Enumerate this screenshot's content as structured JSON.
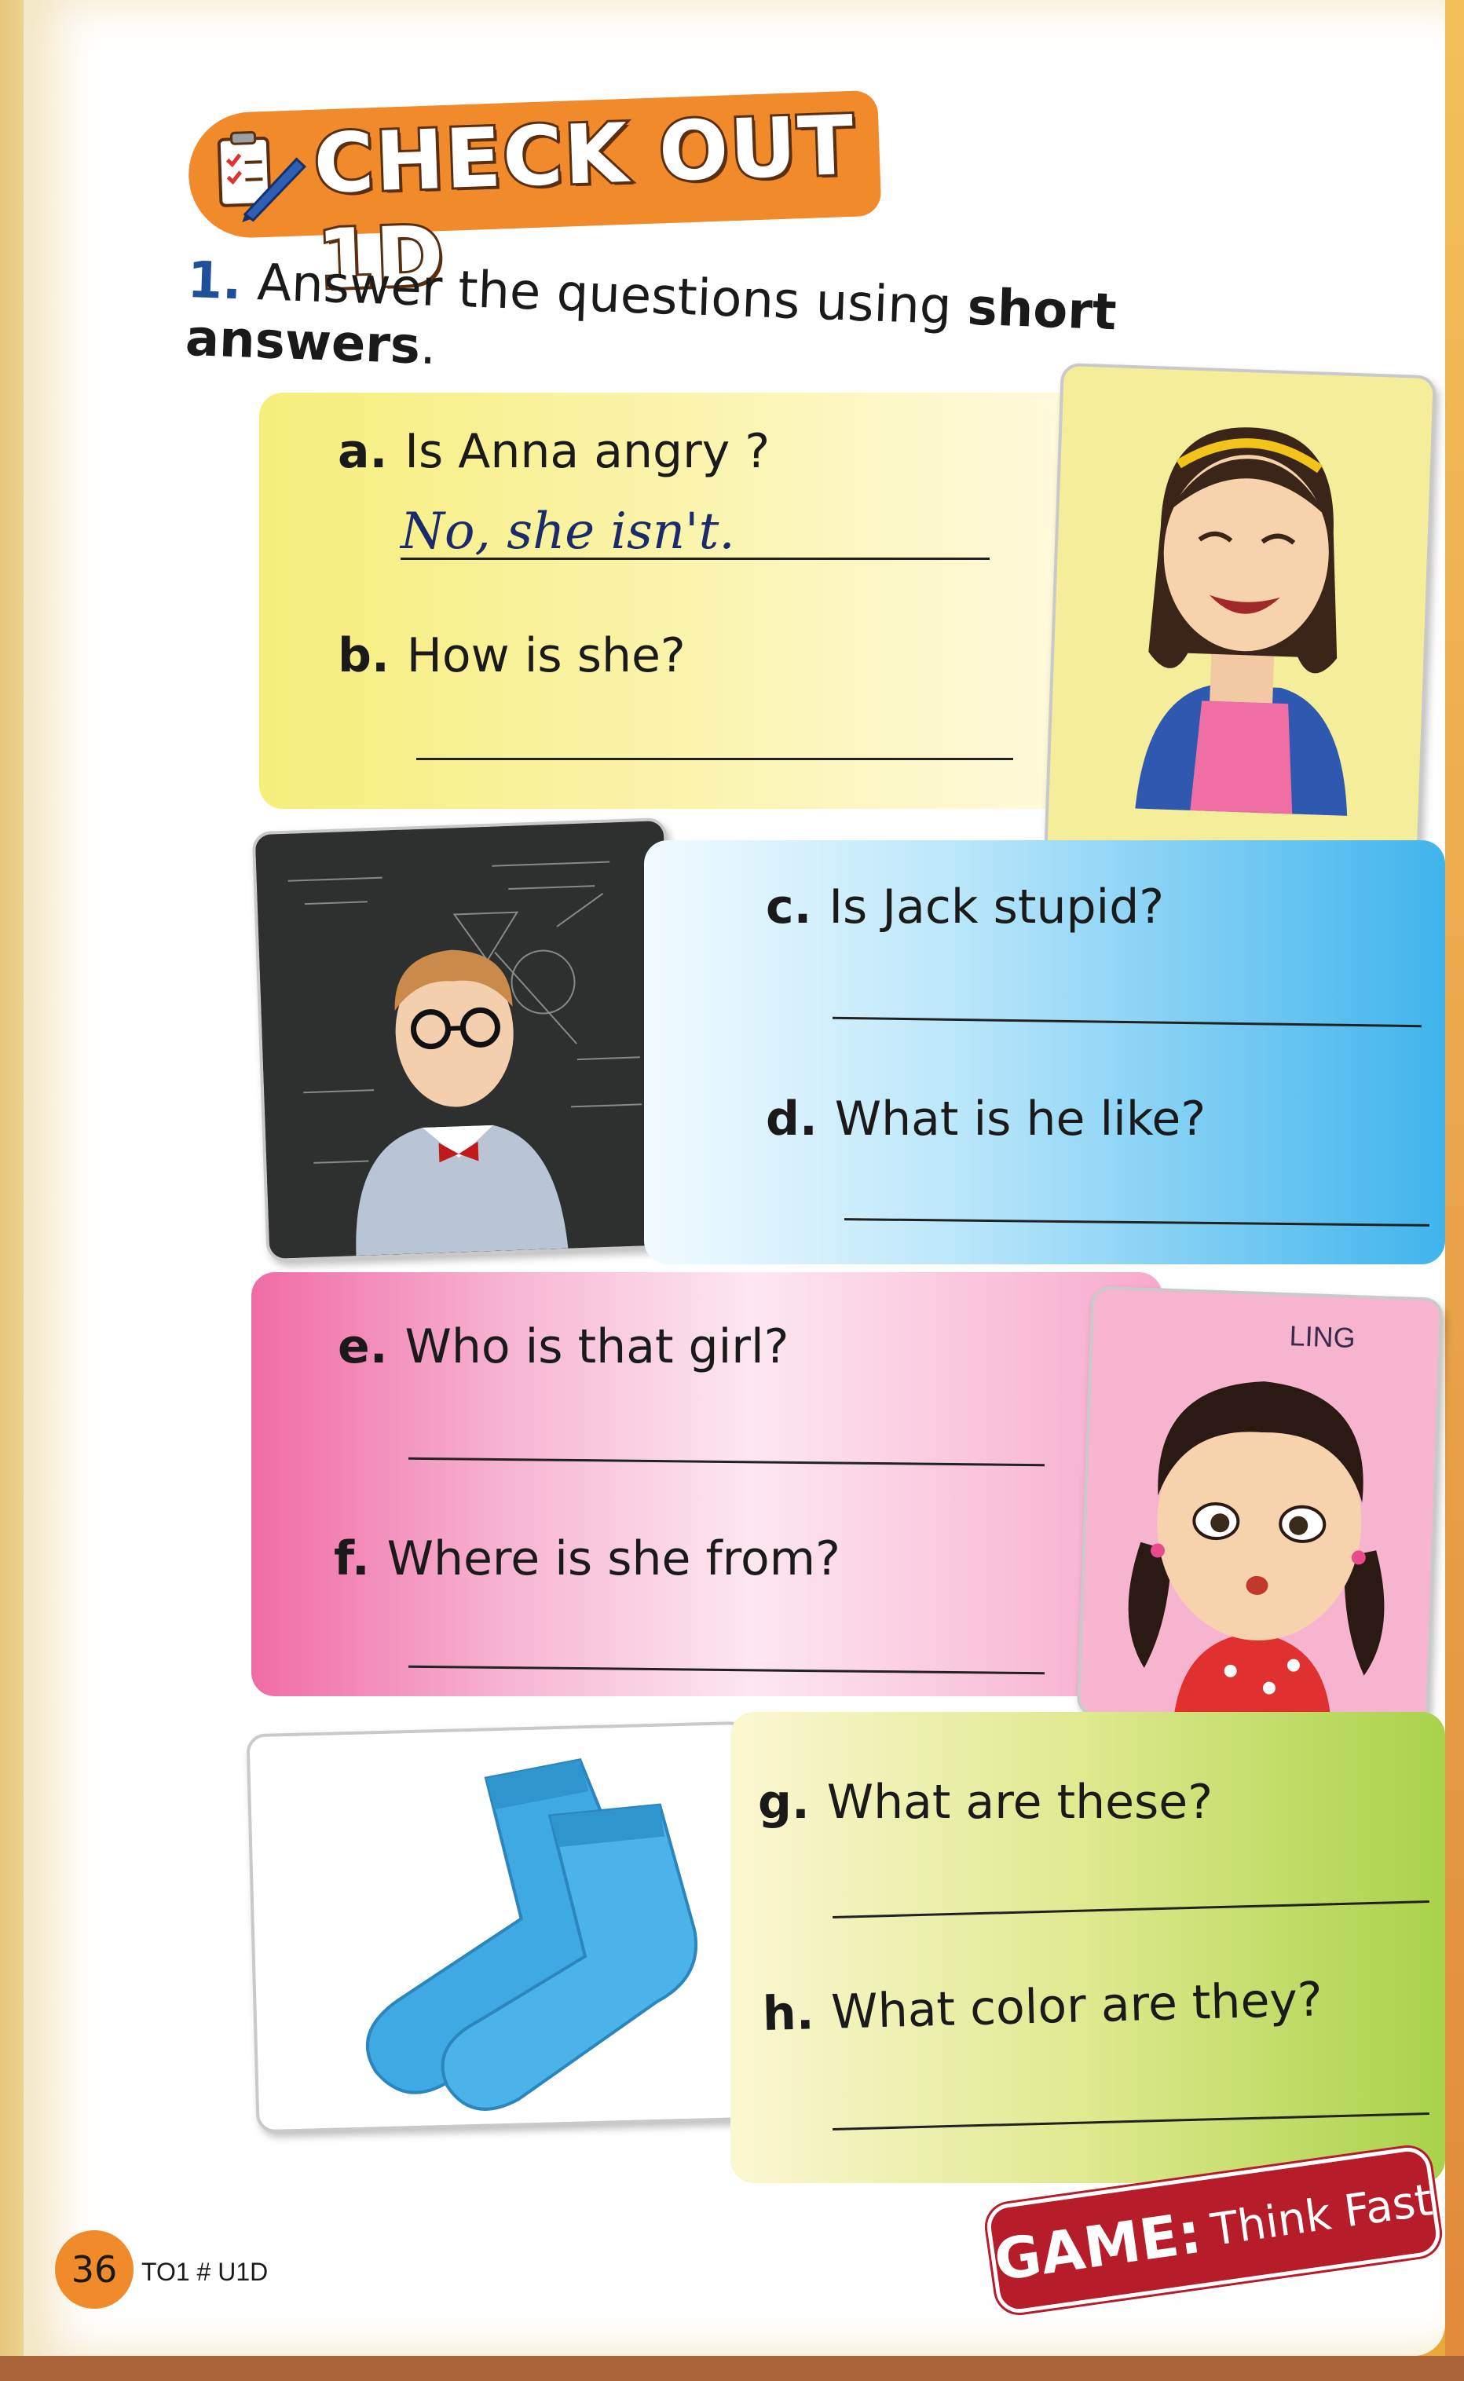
{
  "header": {
    "title": "CHECK OUT 1D"
  },
  "instruction": {
    "number": "1.",
    "text_before": "Answer the questions using ",
    "bold": "short answers",
    "text_after": "."
  },
  "questions": [
    {
      "letter": "a.",
      "text": "Is Anna angry ?",
      "answer": "No, she isn't."
    },
    {
      "letter": "b.",
      "text": "How is she?",
      "answer": ""
    },
    {
      "letter": "c.",
      "text": "Is Jack stupid?",
      "answer": ""
    },
    {
      "letter": "d.",
      "text": "What is he like?",
      "answer": ""
    },
    {
      "letter": "e.",
      "text": "Who is that girl?",
      "answer": ""
    },
    {
      "letter": "f.",
      "text": "Where is she from?",
      "answer": ""
    },
    {
      "letter": "g.",
      "text": "What are these?",
      "answer": ""
    },
    {
      "letter": "h.",
      "text": "What color are they?",
      "answer": ""
    }
  ],
  "ling_label": "LING",
  "game": {
    "bold": "GAME:",
    "rest": "Think Fast"
  },
  "footer": {
    "page_number": "36",
    "code": "TO1 # U1D"
  },
  "colors": {
    "header": "#f08a2a",
    "question_number": "#1f4e9a",
    "panel_yellow": "#f6ee7a",
    "panel_blue": "#3fb4ec",
    "panel_pink": "#f06ba4",
    "panel_green": "#a9d24a",
    "game_badge": "#b71c2a"
  }
}
